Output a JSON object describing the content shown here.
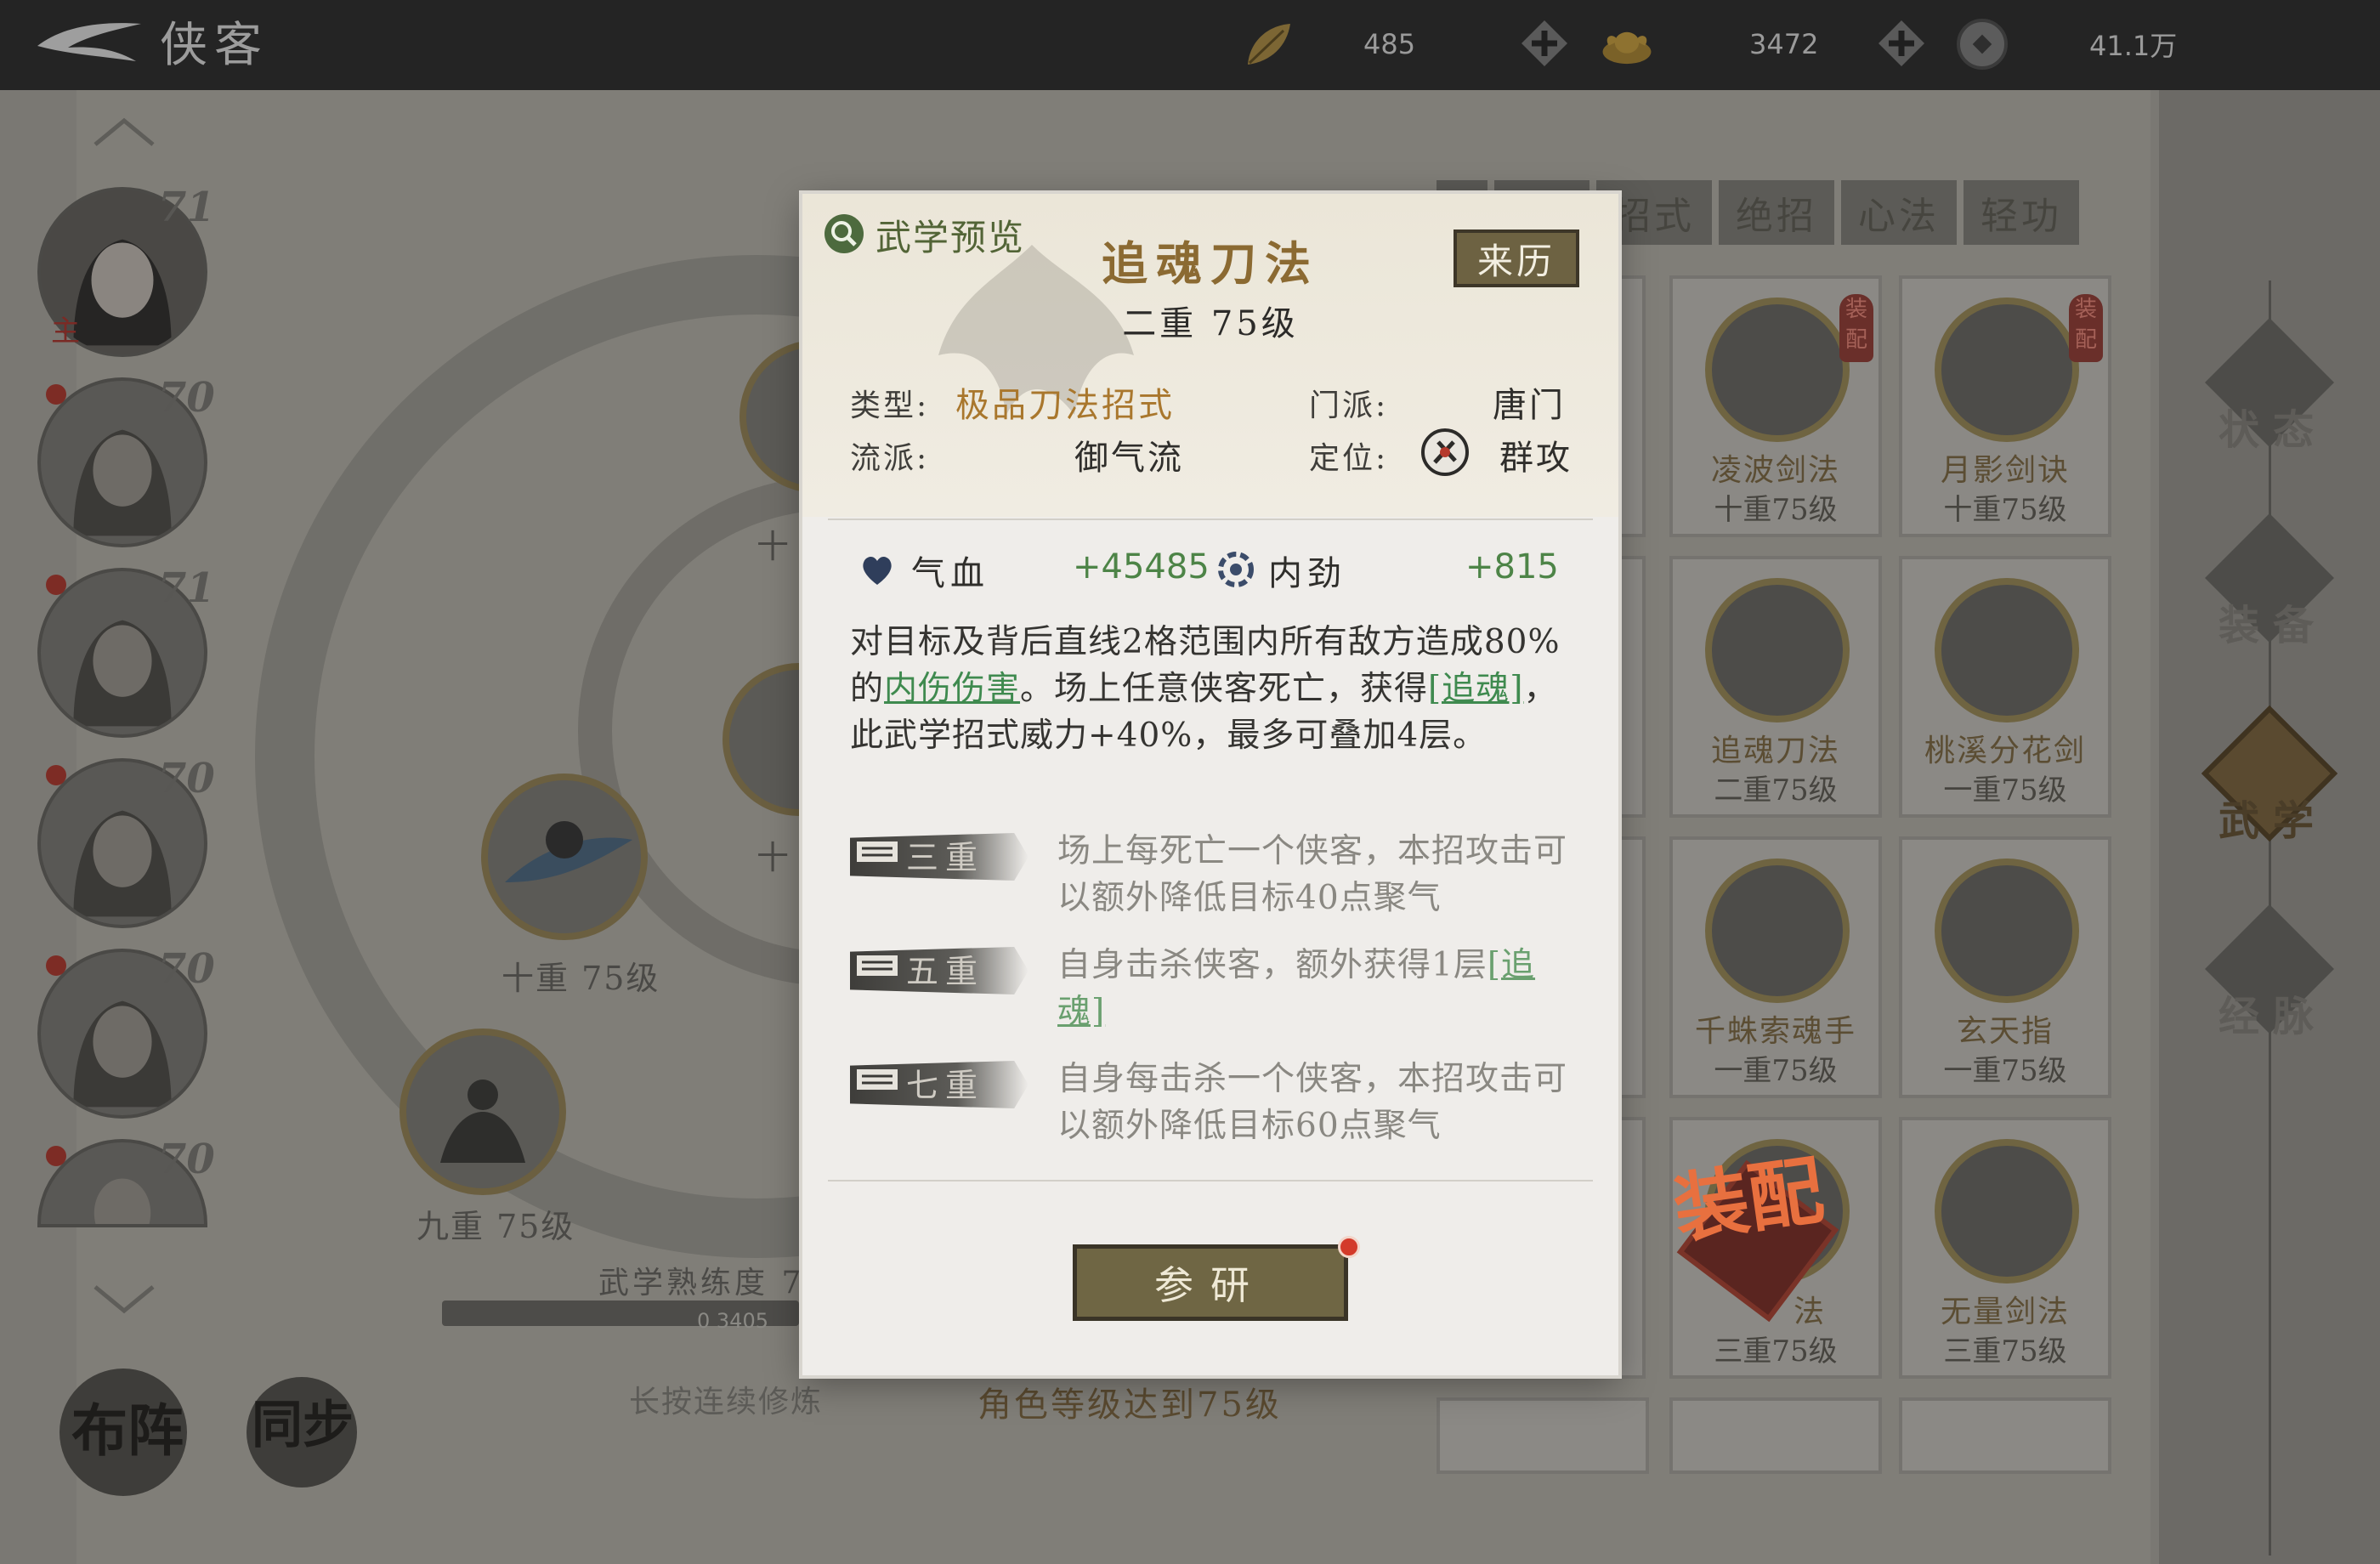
{
  "header": {
    "title": "侠客",
    "resources": [
      {
        "icon": "leaf-currency-icon",
        "value": "485"
      },
      {
        "icon": "gold-ingot-icon",
        "value": "3472"
      },
      {
        "icon": "coin-icon",
        "value": "41.1万"
      }
    ]
  },
  "roster": [
    {
      "level": "71",
      "tag": "主"
    },
    {
      "level": "70"
    },
    {
      "level": "71"
    },
    {
      "level": "70"
    },
    {
      "level": "70"
    },
    {
      "level": "70"
    }
  ],
  "tree": {
    "node_label_1": "十重 75级",
    "node_label_2": "九重 75级",
    "node_label_3": "十",
    "node_label_4": "十",
    "proficiency_label": "武学熟练度 7",
    "proficiency_value": "0 3405",
    "hold_hint": "长按连续修炼",
    "condition_hint": "角色等级达到75级"
  },
  "bottom_buttons": {
    "formation": "布阵",
    "sync": "同步"
  },
  "tabs": [
    "招式",
    "绝招",
    "心法",
    "轻功"
  ],
  "cards": [
    {
      "name": "凌波剑法",
      "level": "十重75级",
      "equipped": true
    },
    {
      "name": "月影剑诀",
      "level": "十重75级",
      "equipped": true
    },
    {
      "name": "追魂刀法",
      "level": "二重75级",
      "equipped": false
    },
    {
      "name": "桃溪分花剑",
      "level": "一重75级",
      "equipped": false
    },
    {
      "name": "千蛛索魂手",
      "level": "一重75级",
      "equipped": false
    },
    {
      "name": "玄天指",
      "level": "一重75级",
      "equipped": false
    },
    {
      "name": "法",
      "level": "三重75级",
      "equipped": false
    },
    {
      "name": "无量剑法",
      "level": "三重75级",
      "equipped": false
    }
  ],
  "equip_mark": "装配",
  "stamp": "装配",
  "right_rail": [
    "状态",
    "装备",
    "武学",
    "经脉"
  ],
  "modal": {
    "preview_label": "武学预览",
    "skill_name": "追魂刀法",
    "skill_level": "二重 75级",
    "origin_button": "来历",
    "type_key": "类型:",
    "type_value": "极品刀法招式",
    "school_key": "门派:",
    "school_value": "唐门",
    "style_key": "流派:",
    "style_value": "御气流",
    "role_key": "定位:",
    "role_value": "群攻",
    "stat_hp_key": "气血",
    "stat_hp_value": "+45485",
    "stat_neijin_key": "内劲",
    "stat_neijin_value": "+815",
    "desc_1": "对目标及背后直线2格范围内所有敌方造成80%的",
    "desc_term_1": "内伤伤害",
    "desc_2": "。场上任意侠客死亡，获得",
    "desc_term_2": "[追魂]",
    "desc_3": "，此武学招式威力+40%，最多可叠加4层。",
    "tiers": [
      {
        "name": "三重",
        "text": "场上每死亡一个侠客，本招攻击可以额外降低目标40点聚气"
      },
      {
        "name": "五重",
        "text": "自身击杀侠客，额外获得1层",
        "term": "[追魂]"
      },
      {
        "name": "七重",
        "text": "自身每击杀一个侠客，本招攻击可以额外降低目标60点聚气"
      }
    ],
    "research_button": "参研"
  }
}
